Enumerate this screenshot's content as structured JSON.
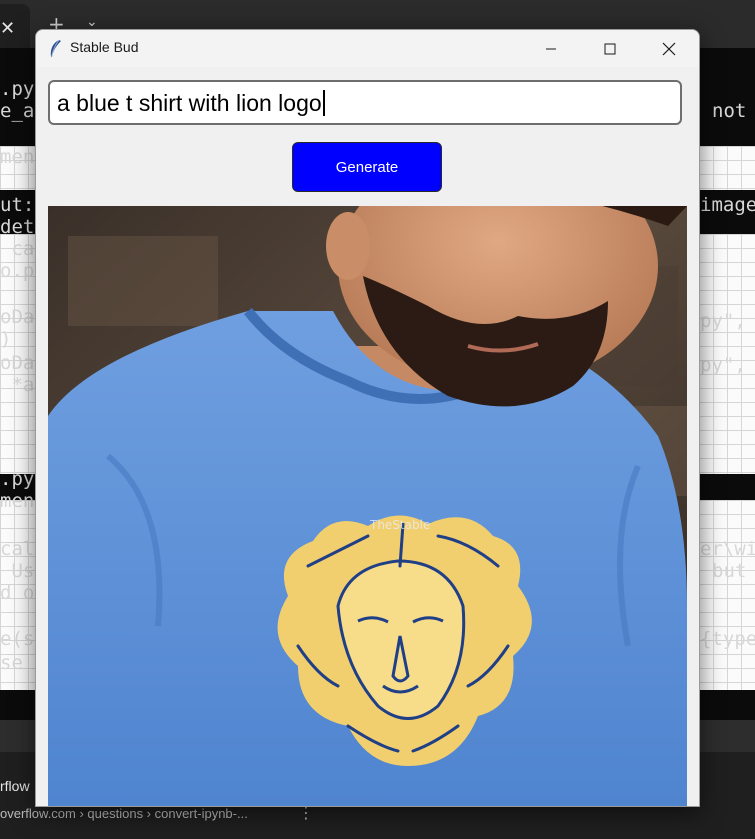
{
  "window": {
    "title": "Stable Bud",
    "prompt_value": "a blue t shirt with lion logo",
    "generate_label": "Generate",
    "image_watermark": "TheStable"
  },
  "background": {
    "code_lines_left": [
      ".py",
      "e_au",
      "ment",
      "ut:",
      "dete",
      " ca",
      "o.py",
      "oDat",
      ")",
      "oDat",
      " *ar",
      ".py",
      "ment",
      "cal\\",
      " Use",
      "d or",
      "e(se",
      "se ("
    ],
    "code_lines_right": [
      "not",
      "image",
      "py\",",
      "py\",",
      "er\\wi",
      "but",
      "{type"
    ],
    "link_title": "rflow",
    "link_url": "overflow.com › questions › convert-ipynb-..."
  },
  "colors": {
    "generate_button": "#0000ff",
    "shirt": "#5b8fd6",
    "lion": "#f2cf6e"
  }
}
